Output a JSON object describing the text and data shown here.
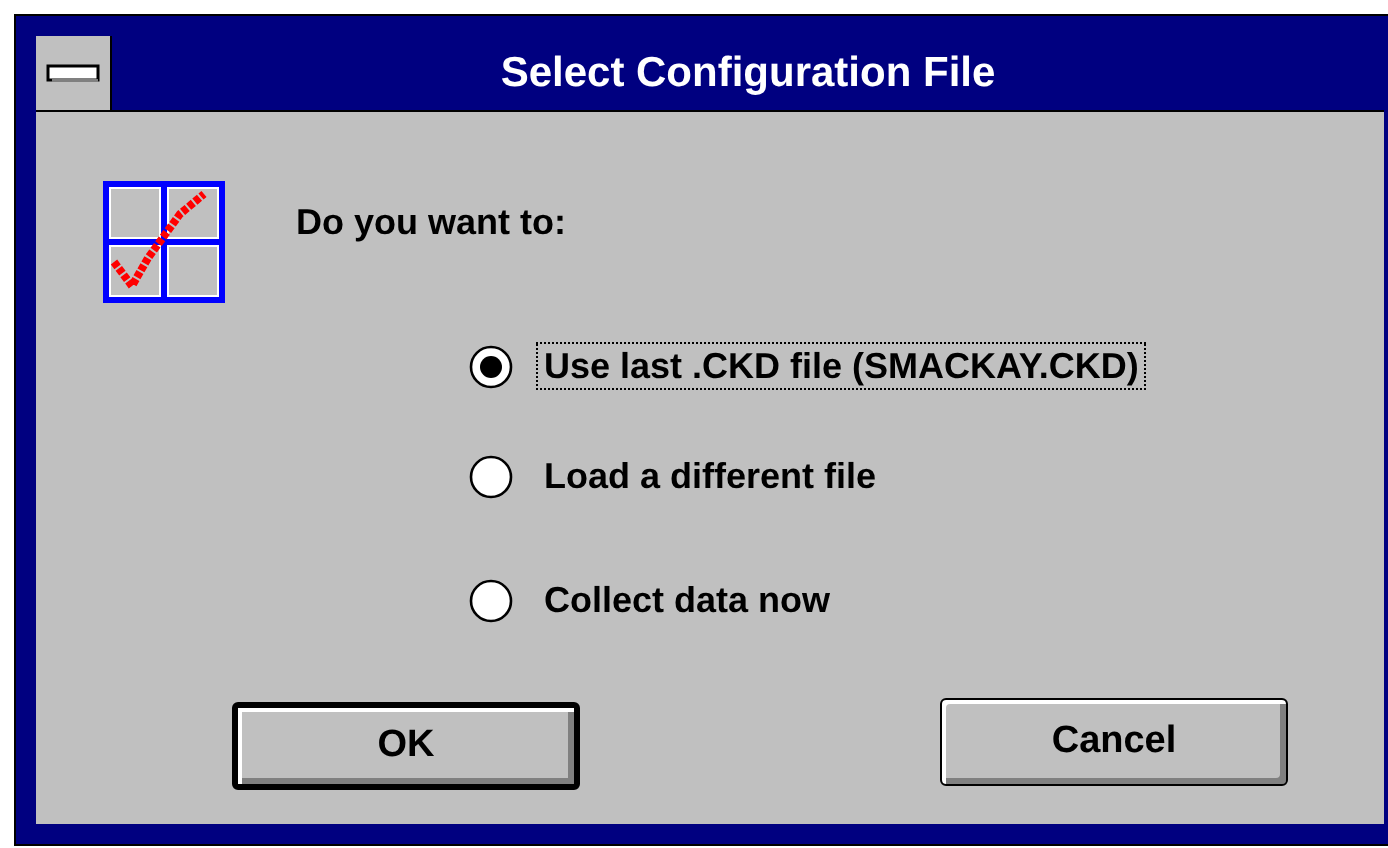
{
  "window": {
    "title": "Select Configuration File"
  },
  "prompt": "Do you want to:",
  "options": [
    {
      "label": "Use last .CKD file (SMACKAY.CKD)",
      "selected": true,
      "focused": true
    },
    {
      "label": "Load a different file",
      "selected": false,
      "focused": false
    },
    {
      "label": "Collect data now",
      "selected": false,
      "focused": false
    }
  ],
  "buttons": [
    {
      "label": "OK",
      "default": true
    },
    {
      "label": "Cancel",
      "default": false
    }
  ]
}
